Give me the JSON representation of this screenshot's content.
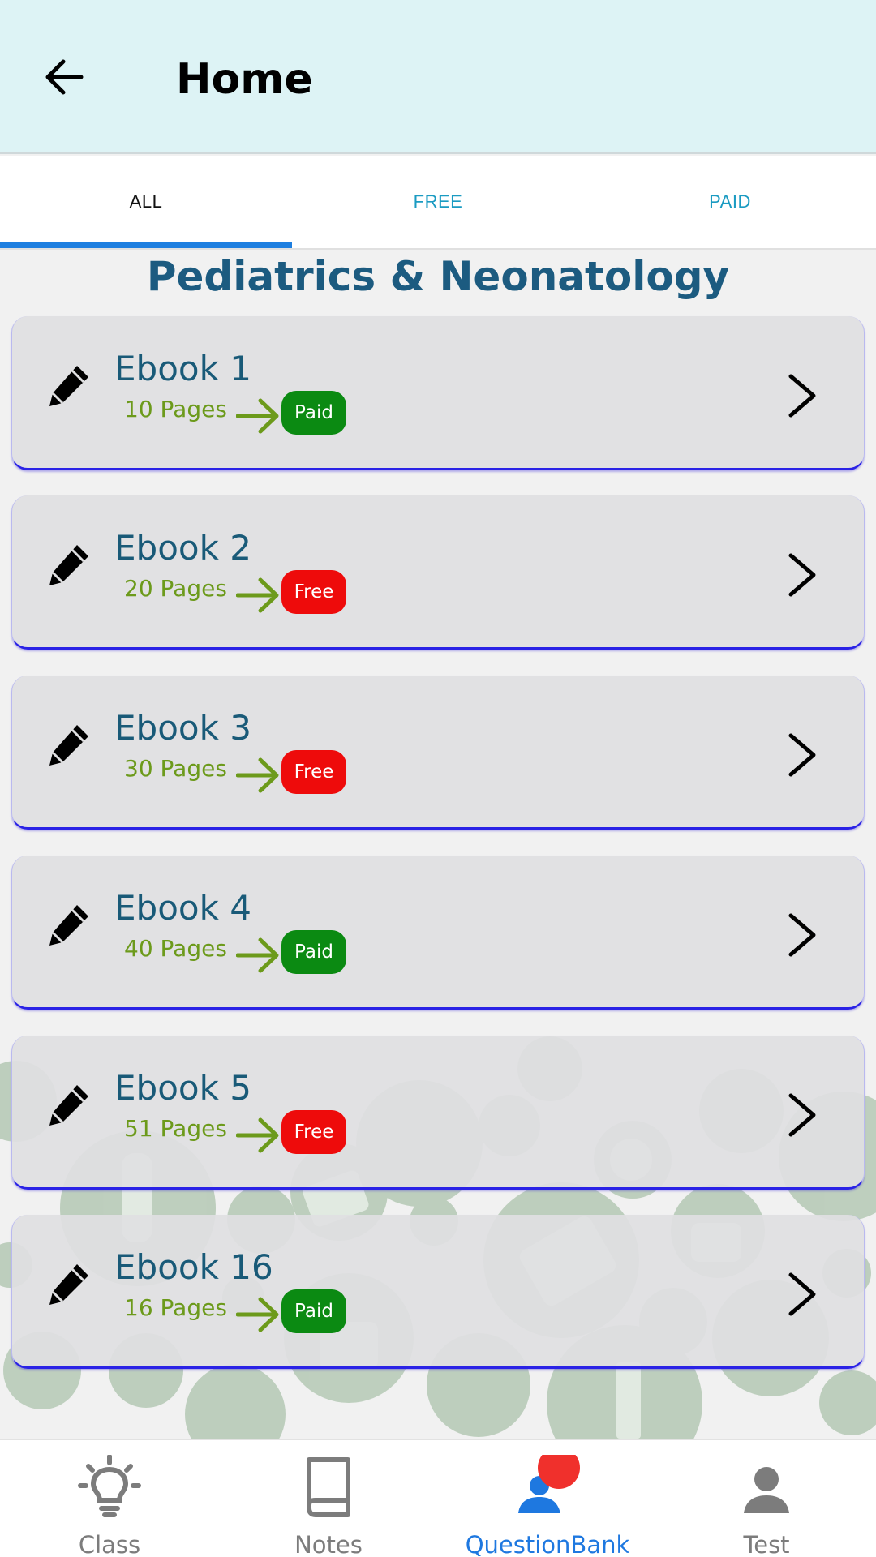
{
  "header": {
    "title": "Home",
    "back_icon": "arrow-left-icon"
  },
  "tabs": [
    {
      "label": "ALL",
      "active": true
    },
    {
      "label": "FREE",
      "active": false
    },
    {
      "label": "PAID",
      "active": false
    }
  ],
  "section": {
    "title": "Pediatrics & Neonatology"
  },
  "ebooks": [
    {
      "title": "Ebook 1",
      "pages": "10 Pages",
      "badge": "Paid"
    },
    {
      "title": "Ebook 2",
      "pages": "20 Pages",
      "badge": "Free"
    },
    {
      "title": "Ebook 3",
      "pages": "30 Pages",
      "badge": "Free"
    },
    {
      "title": "Ebook 4",
      "pages": "40 Pages",
      "badge": "Paid"
    },
    {
      "title": "Ebook 5",
      "pages": "51 Pages",
      "badge": "Free"
    },
    {
      "title": "Ebook 16",
      "pages": "16 Pages",
      "badge": "Paid"
    }
  ],
  "badge_colors": {
    "Paid": "#0b8a12",
    "Free": "#ee0b0b"
  },
  "bottom_nav": [
    {
      "label": "Class",
      "icon": "lightbulb-icon",
      "active": false
    },
    {
      "label": "Notes",
      "icon": "book-icon",
      "active": false
    },
    {
      "label": "QuestionBank",
      "icon": "group-icon",
      "active": true
    },
    {
      "label": "Test",
      "icon": "person-icon",
      "active": false
    }
  ],
  "colors": {
    "appbar": "#ddf3f5",
    "accent": "#1e7fe0",
    "title": "#1c5b80",
    "pages": "#6c9a1b"
  }
}
